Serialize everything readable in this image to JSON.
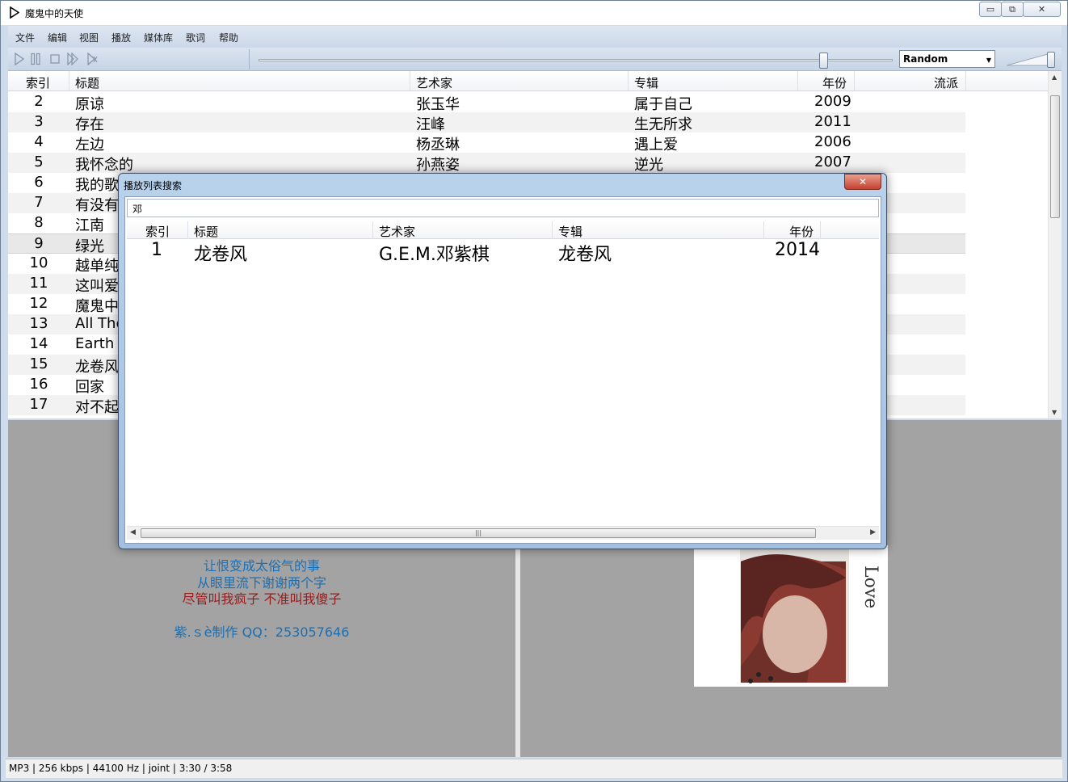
{
  "window": {
    "title": "魔鬼中的天使",
    "min_glyph": "▭",
    "max_glyph": "⧉",
    "close_glyph": "✕"
  },
  "menu": [
    "文件",
    "编辑",
    "视图",
    "播放",
    "媒体库",
    "歌词",
    "帮助"
  ],
  "toolbar": {
    "play_mode": "Random",
    "seek_fraction": 0.89,
    "volume_fraction": 1.0
  },
  "playlist": {
    "columns": [
      "索引",
      "标题",
      "艺术家",
      "专辑",
      "年份",
      "流派"
    ],
    "rows": [
      {
        "index": "2",
        "title": "原谅",
        "artist": "张玉华",
        "album": "属于自己",
        "year": "2009"
      },
      {
        "index": "3",
        "title": "存在",
        "artist": "汪峰",
        "album": "生无所求",
        "year": "2011"
      },
      {
        "index": "4",
        "title": "左边",
        "artist": "杨丞琳",
        "album": "遇上爱",
        "year": "2006"
      },
      {
        "index": "5",
        "title": "我怀念的",
        "artist": "孙燕姿",
        "album": "逆光",
        "year": "2007"
      },
      {
        "index": "6",
        "title": "我的歌",
        "artist": "",
        "album": "",
        "year": ""
      },
      {
        "index": "7",
        "title": "有没有",
        "artist": "",
        "album": "",
        "year": ""
      },
      {
        "index": "8",
        "title": "江南",
        "artist": "",
        "album": "",
        "year": ""
      },
      {
        "index": "9",
        "title": "绿光",
        "artist": "",
        "album": "",
        "year": ""
      },
      {
        "index": "10",
        "title": "越单纯",
        "artist": "",
        "album": "",
        "year": ""
      },
      {
        "index": "11",
        "title": "这叫爱",
        "artist": "",
        "album": "",
        "year": ""
      },
      {
        "index": "12",
        "title": "魔鬼中",
        "artist": "",
        "album": "",
        "year": ""
      },
      {
        "index": "13",
        "title": "All The",
        "artist": "",
        "album": "",
        "year": ""
      },
      {
        "index": "14",
        "title": "Earth",
        "artist": "",
        "album": "",
        "year": ""
      },
      {
        "index": "15",
        "title": "龙卷风",
        "artist": "",
        "album": "",
        "year": ""
      },
      {
        "index": "16",
        "title": "回家",
        "artist": "",
        "album": "",
        "year": ""
      },
      {
        "index": "17",
        "title": "对不起",
        "artist": "",
        "album": "",
        "year": ""
      }
    ],
    "selected_index": "9"
  },
  "lyrics": {
    "lines": [
      {
        "text": "让恨变成太俗气的事",
        "color": "#1a6fb5"
      },
      {
        "text": "从眼里流下谢谢两个字",
        "color": "#1a6fb5"
      },
      {
        "text": "尽管叫我疯子 不准叫我傻子",
        "color": "#9b1a1a"
      },
      {
        "text": "紫.ｓè制作  QQ：253057646",
        "color": "#1a6fb5"
      }
    ]
  },
  "album_art": {
    "caption": "Love"
  },
  "status": "MP3 | 256 kbps | 44100 Hz | joint | 3:30 / 3:58",
  "search_dialog": {
    "title": "播放列表搜索",
    "close_glyph": "✕",
    "query": "邓",
    "columns": [
      "索引",
      "标题",
      "艺术家",
      "专辑",
      "年份"
    ],
    "results": [
      {
        "index": "1",
        "title": "龙卷风",
        "artist": "G.E.M.邓紫棋",
        "album": "龙卷风",
        "year": "2014"
      }
    ],
    "scroll_grip": "|||"
  }
}
